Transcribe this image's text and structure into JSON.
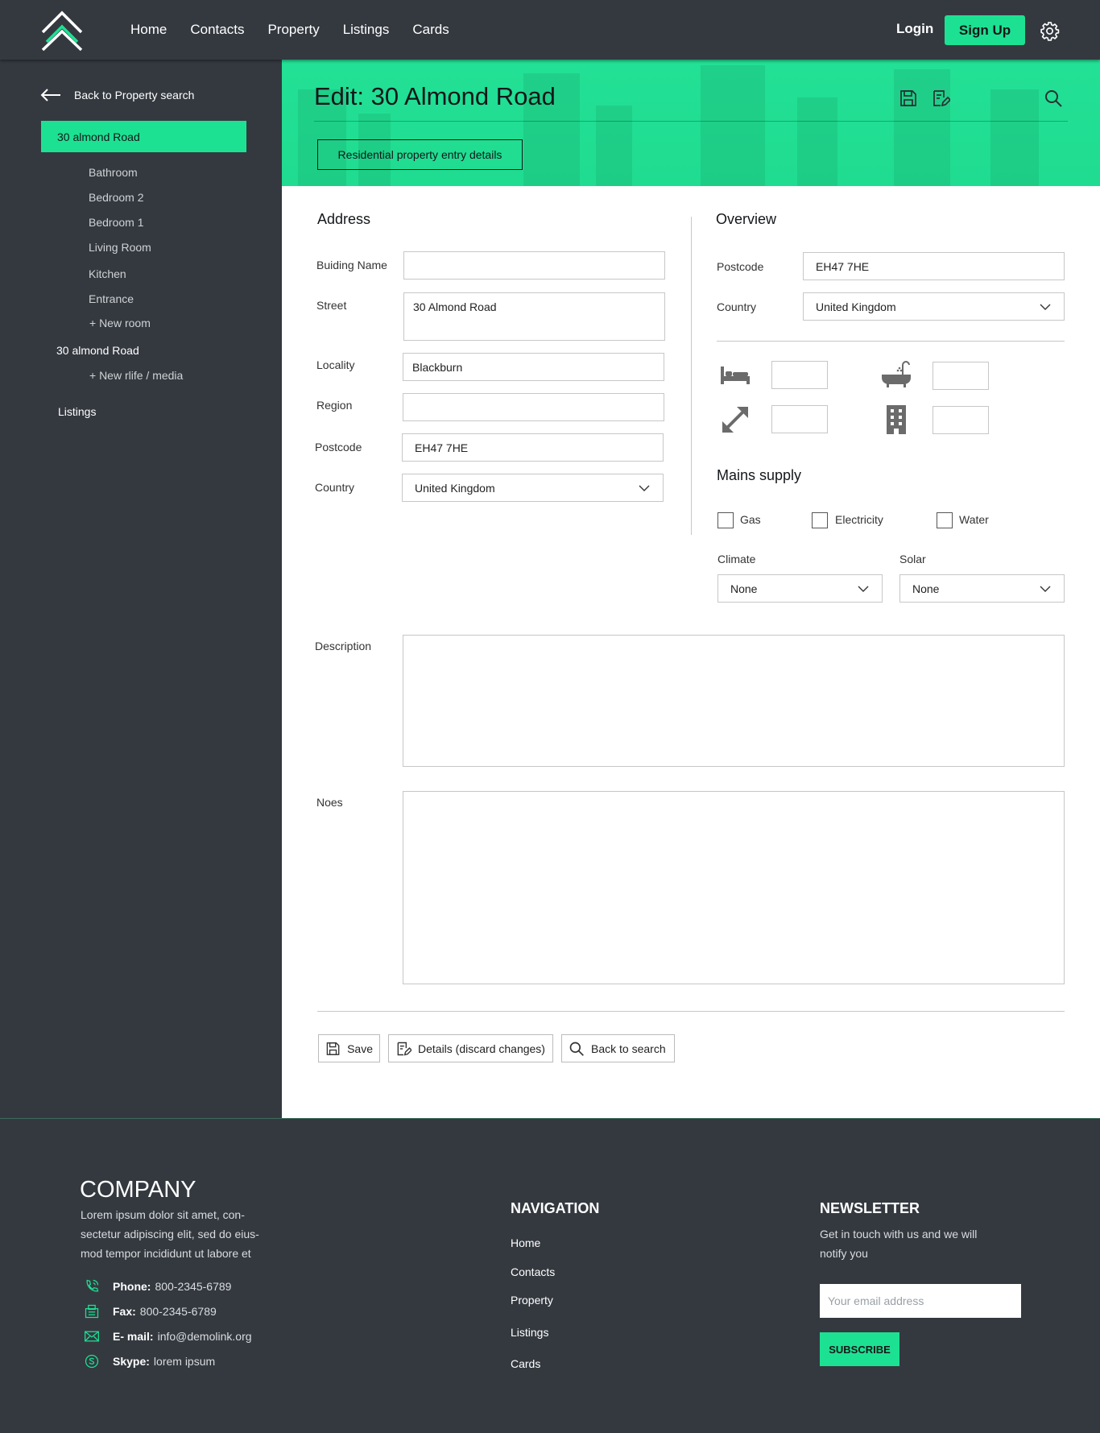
{
  "header": {
    "nav": [
      "Home",
      "Contacts",
      "Property",
      "Listings",
      "Cards"
    ],
    "login": "Login",
    "signup": "Sign Up"
  },
  "sidebar": {
    "back": "Back to Property search",
    "active_property": "30 almond Road",
    "rooms": [
      "Bathroom",
      "Bedroom 2",
      "Bedroom 1",
      "Living Room",
      "Kitchen",
      "Entrance",
      "+ New room"
    ],
    "property2": "30 almond Road",
    "new_media": "+ New rlife / media",
    "listings": "Listings"
  },
  "hero": {
    "title": "Edit: 30 Almond Road",
    "button": "Residential property entry details",
    "icons": [
      "save-icon",
      "edit-icon",
      "search-icon"
    ]
  },
  "address": {
    "heading": "Address",
    "building_label": "Buiding Name",
    "building_value": "",
    "street_label": "Street",
    "street_value": "30 Almond Road",
    "locality_label": "Locality",
    "locality_value": "Blackburn",
    "region_label": "Region",
    "region_value": "",
    "postcode_label": "Postcode",
    "postcode_value": "EH47 7HE",
    "country_label": "Country",
    "country_value": "United Kingdom"
  },
  "overview": {
    "heading": "Overview",
    "postcode_label": "Postcode",
    "postcode_value": "EH47 7HE",
    "country_label": "Country",
    "country_value": "United Kingdom",
    "feature_icons": [
      "bed-icon",
      "bath-icon",
      "expand-icon",
      "building-icon"
    ]
  },
  "mains": {
    "heading": "Mains supply",
    "gas": "Gas",
    "electricity": "Electricity",
    "water": "Water",
    "climate_label": "Climate",
    "climate_value": "None",
    "solar_label": "Solar",
    "solar_value": "None"
  },
  "description_label": "Description",
  "notes_label": "Noes",
  "actions": {
    "save": "Save",
    "details": "Details (discard changes)",
    "back": "Back to search"
  },
  "footer": {
    "company": "COMPANY",
    "about": [
      "Lorem ipsum dolor sit amet, con-",
      "sectetur adipiscing elit, sed do eius-",
      "mod tempor incididunt ut labore et"
    ],
    "phone_label": "Phone:",
    "phone": "800-2345-6789",
    "fax_label": "Fax:",
    "fax": "800-2345-6789",
    "email_label": "E- mail:",
    "email": "info@demolink.org",
    "skype_label": "Skype:",
    "skype": "lorem ipsum",
    "nav_heading": "NAVIGATION",
    "nav": [
      "Home",
      "Contacts",
      "Property",
      "Listings",
      "Cards"
    ],
    "newsletter_heading": "NEWSLETTER",
    "newsletter_text": [
      "Get in touch with us and we will",
      "notify you"
    ],
    "email_placeholder": "Your email address",
    "subscribe": "SUBSCRIBE"
  },
  "colors": {
    "accent": "#1de192",
    "dark": "#343940"
  }
}
